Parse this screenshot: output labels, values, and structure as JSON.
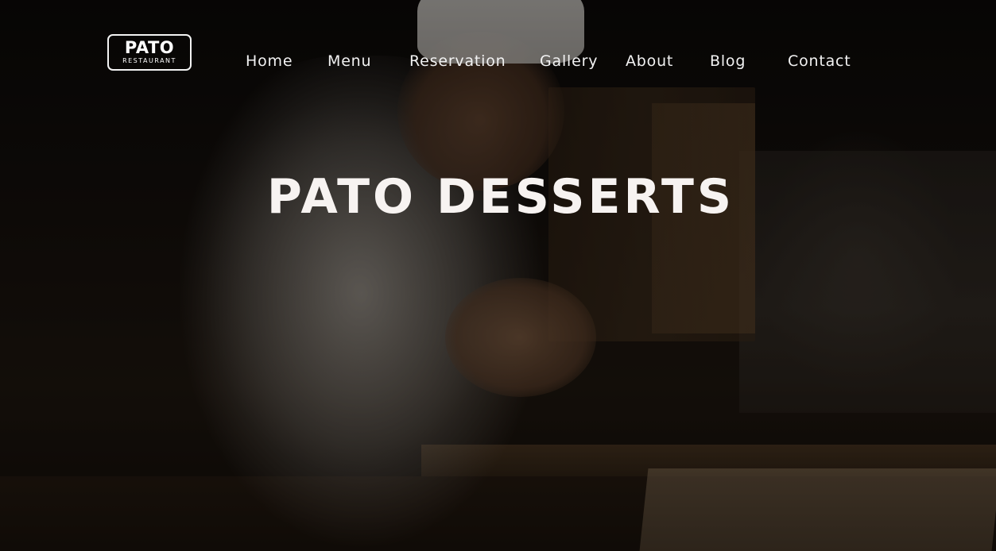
{
  "brand": {
    "name": "PATO",
    "tagline": "RESTAURANT"
  },
  "nav": {
    "items": [
      {
        "label": "Home"
      },
      {
        "label": "Menu"
      },
      {
        "label": "Reservation"
      },
      {
        "label": "Gallery"
      },
      {
        "label": "About"
      },
      {
        "label": "Blog"
      },
      {
        "label": "Contact"
      }
    ]
  },
  "hero": {
    "title": "PATO DESSERTS",
    "background_image": "chef-preparing-sushi-photo"
  },
  "colors": {
    "text": "#f2f2f2",
    "title": "#f7f3f1",
    "overlay": "#000000"
  }
}
